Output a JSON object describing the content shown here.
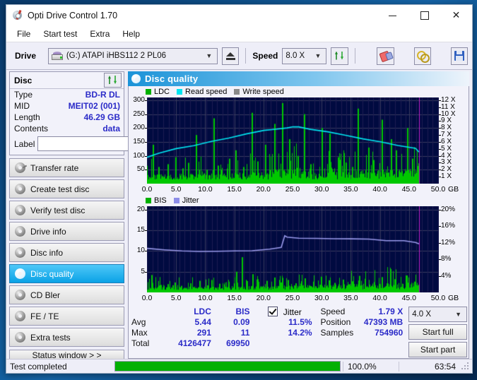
{
  "window": {
    "title": "Opti Drive Control 1.70",
    "icon": "disc-icon",
    "buttons": {
      "minimize": "minimize",
      "maximize": "maximize",
      "close": "close"
    }
  },
  "menu": {
    "items": [
      "File",
      "Start test",
      "Extra",
      "Help"
    ]
  },
  "toolbar": {
    "drive_label": "Drive",
    "drive_value": "(G:)  ATAPI iHBS112  2 PL06",
    "eject_icon": "eject-icon",
    "speed_label": "Speed",
    "speed_value": "8.0 X",
    "refresh_icon": "refresh-icon",
    "eraser_icon": "eraser-icon",
    "chain_icon": "chain-icon",
    "save_icon": "floppy-disk-icon"
  },
  "disc_panel": {
    "header": "Disc",
    "refresh_icon": "refresh-icon",
    "rows": [
      {
        "key": "Type",
        "value": "BD-R DL"
      },
      {
        "key": "MID",
        "value": "MEIT02 (001)"
      },
      {
        "key": "Length",
        "value": "46.29 GB"
      },
      {
        "key": "Contents",
        "value": "data"
      }
    ],
    "label_key": "Label",
    "label_value": "",
    "label_placeholder": "",
    "cd_icon": "cd-icon"
  },
  "sidebar": {
    "items": [
      {
        "label": "Transfer rate",
        "icon": "disc-icon",
        "selected": false
      },
      {
        "label": "Create test disc",
        "icon": "disc-icon",
        "selected": false
      },
      {
        "label": "Verify test disc",
        "icon": "disc-icon",
        "selected": false
      },
      {
        "label": "Drive info",
        "icon": "disc-icon",
        "selected": false
      },
      {
        "label": "Disc info",
        "icon": "disc-icon",
        "selected": false
      },
      {
        "label": "Disc quality",
        "icon": "disc-icon",
        "selected": true
      },
      {
        "label": "CD Bler",
        "icon": "disc-icon",
        "selected": false
      },
      {
        "label": "FE / TE",
        "icon": "disc-icon",
        "selected": false
      },
      {
        "label": "Extra tests",
        "icon": "disc-icon",
        "selected": false
      }
    ],
    "status_button": "Status window > >"
  },
  "content": {
    "header_title": "Disc quality",
    "header_icon": "disc-icon"
  },
  "chart_data": [
    {
      "type": "line",
      "id": "ldc-chart",
      "title": "",
      "legend": [
        {
          "label": "LDC",
          "color": "#00b000"
        },
        {
          "label": "Read speed",
          "color": "#00e5f0"
        },
        {
          "label": "Write speed",
          "color": "#8a8a8a"
        }
      ],
      "legend_position": "top-left",
      "xlabel": "GB",
      "x_ticks": [
        "0.0",
        "5.0",
        "10.0",
        "15.0",
        "20.0",
        "25.0",
        "30.0",
        "35.0",
        "40.0",
        "45.0",
        "50.0"
      ],
      "xlim": [
        0,
        50
      ],
      "ylabel_left": "LDC",
      "y_ticks_left": [
        "50",
        "100",
        "150",
        "200",
        "250",
        "300"
      ],
      "ylim_left": [
        0,
        310
      ],
      "ylabel_right": "Speed",
      "y_ticks_right": [
        "1 X",
        "2 X",
        "3 X",
        "4 X",
        "5 X",
        "6 X",
        "7 X",
        "8 X",
        "9 X",
        "10 X",
        "11 X",
        "12 X"
      ],
      "ylim_right": [
        0,
        12.4
      ],
      "plot_bg": "#000a40",
      "grid": true,
      "marker_line_x": 46.6,
      "marker_line_color": "#c020c8",
      "series": [
        {
          "name": "Read speed",
          "color": "#00e5f0",
          "axis": "right",
          "x": [
            0,
            2,
            5,
            8,
            11,
            14,
            17,
            20,
            22,
            24,
            25,
            26,
            28,
            31,
            34,
            37,
            40,
            43,
            46,
            46.6
          ],
          "values": [
            3.8,
            4.3,
            5.0,
            5.5,
            6.1,
            6.6,
            7.1,
            7.6,
            7.9,
            8.1,
            8.2,
            8.1,
            7.8,
            7.4,
            7.0,
            6.5,
            6.0,
            5.5,
            5.0,
            4.6
          ]
        },
        {
          "name": "LDC",
          "color": "#00c800",
          "axis": "left",
          "baseline": 28,
          "peak_values": [
            140,
            60,
            70,
            95,
            55,
            75,
            175,
            50,
            235,
            65,
            90,
            120,
            60,
            255,
            80,
            140,
            215,
            290,
            160,
            100,
            250,
            70,
            200,
            180,
            95,
            110,
            60,
            270,
            130,
            85,
            230,
            160,
            120,
            200,
            90
          ]
        }
      ]
    },
    {
      "type": "line",
      "id": "bis-jitter-chart",
      "title": "",
      "legend": [
        {
          "label": "BIS",
          "color": "#00b000"
        },
        {
          "label": "Jitter",
          "color": "#8d8de8"
        }
      ],
      "legend_position": "top-left",
      "xlabel": "GB",
      "x_ticks": [
        "0.0",
        "5.0",
        "10.0",
        "15.0",
        "20.0",
        "25.0",
        "30.0",
        "35.0",
        "40.0",
        "45.0",
        "50.0"
      ],
      "xlim": [
        0,
        50
      ],
      "ylabel_left": "BIS",
      "y_ticks_left": [
        "5",
        "10",
        "15",
        "20"
      ],
      "ylim_left": [
        0,
        20.8
      ],
      "ylabel_right": "Jitter",
      "y_ticks_right": [
        "4%",
        "8%",
        "12%",
        "16%",
        "20%"
      ],
      "ylim_right": [
        0,
        20.8
      ],
      "plot_bg": "#000a40",
      "grid": true,
      "marker_line_x": 46.6,
      "marker_line_color": "#c020c8",
      "series": [
        {
          "name": "Jitter",
          "color": "#9a9aec",
          "axis": "right",
          "x": [
            0,
            3,
            6,
            9,
            12,
            15,
            18,
            21,
            23,
            23.6,
            24,
            26,
            29,
            32,
            35,
            38,
            41,
            44,
            46,
            46.6
          ],
          "values": [
            10.5,
            10.2,
            10.0,
            10.0,
            10.0,
            10.1,
            10.2,
            10.4,
            10.8,
            13.6,
            13.4,
            13.2,
            13.1,
            13.0,
            12.9,
            12.8,
            12.6,
            12.4,
            12.0,
            11.7
          ]
        },
        {
          "name": "BIS",
          "color": "#00c800",
          "axis": "left",
          "baseline": 1.2,
          "peak_values": [
            4.2,
            1.8,
            2.0,
            2.4,
            1.6,
            2.2,
            2.8,
            1.7,
            3.0,
            2.1,
            2.6,
            5.0,
            8.5,
            4.4,
            3.2,
            2.8,
            3.6,
            2.4,
            3.0,
            2.2,
            3.4,
            2.6,
            3.8,
            2.9,
            2.3,
            3.1,
            2.7,
            4.0,
            3.3,
            2.5,
            3.7,
            2.8,
            3.2,
            4.1,
            2.6
          ]
        }
      ]
    }
  ],
  "stats": {
    "col_headers": [
      "LDC",
      "BIS"
    ],
    "row_labels": [
      "Avg",
      "Max",
      "Total"
    ],
    "ldc": {
      "avg": "5.44",
      "max": "291",
      "total": "4126477"
    },
    "bis": {
      "avg": "0.09",
      "max": "11",
      "total": "69950"
    },
    "jitter": {
      "label": "Jitter",
      "checked": true,
      "avg": "11.5%",
      "max": "14.2%"
    },
    "speed": {
      "label": "Speed",
      "value": "1.79 X"
    },
    "position": {
      "label": "Position",
      "value": "47393 MB"
    },
    "samples": {
      "label": "Samples",
      "value": "754960"
    },
    "speed_select": "4.0 X",
    "start_full": "Start full",
    "start_part": "Start part"
  },
  "statusbar": {
    "message": "Test completed",
    "progress_percent": 100,
    "progress_text": "100.0%",
    "elapsed": "63:54"
  }
}
